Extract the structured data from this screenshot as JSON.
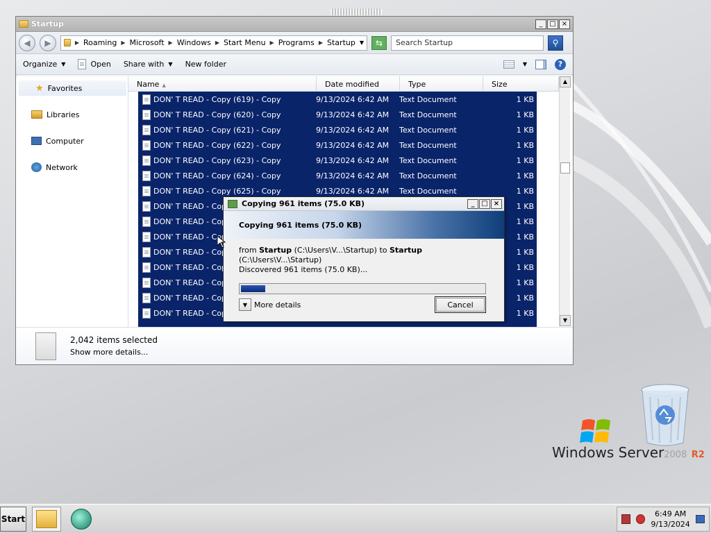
{
  "explorer": {
    "title": "Startup",
    "breadcrumb": [
      "Roaming",
      "Microsoft",
      "Windows",
      "Start Menu",
      "Programs",
      "Startup"
    ],
    "search_placeholder": "Search Startup",
    "toolbar": {
      "organize": "Organize",
      "open": "Open",
      "share_with": "Share with",
      "new_folder": "New folder"
    },
    "nav": {
      "favorites": "Favorites",
      "libraries": "Libraries",
      "computer": "Computer",
      "network": "Network"
    },
    "columns": {
      "name": "Name",
      "date": "Date modified",
      "type": "Type",
      "size": "Size"
    },
    "rows": [
      {
        "name": "DON' T READ - Copy (619) - Copy",
        "date": "9/13/2024 6:42 AM",
        "type": "Text Document",
        "size": "1 KB"
      },
      {
        "name": "DON' T READ - Copy (620) - Copy",
        "date": "9/13/2024 6:42 AM",
        "type": "Text Document",
        "size": "1 KB"
      },
      {
        "name": "DON' T READ - Copy (621) - Copy",
        "date": "9/13/2024 6:42 AM",
        "type": "Text Document",
        "size": "1 KB"
      },
      {
        "name": "DON' T READ - Copy (622) - Copy",
        "date": "9/13/2024 6:42 AM",
        "type": "Text Document",
        "size": "1 KB"
      },
      {
        "name": "DON' T READ - Copy (623) - Copy",
        "date": "9/13/2024 6:42 AM",
        "type": "Text Document",
        "size": "1 KB"
      },
      {
        "name": "DON' T READ - Copy (624) - Copy",
        "date": "9/13/2024 6:42 AM",
        "type": "Text Document",
        "size": "1 KB"
      },
      {
        "name": "DON' T READ - Copy (625) - Copy",
        "date": "9/13/2024 6:42 AM",
        "type": "Text Document",
        "size": "1 KB"
      },
      {
        "name": "DON' T READ - Copy",
        "date": "",
        "type": "",
        "size": "1 KB"
      },
      {
        "name": "DON' T READ - Copy",
        "date": "",
        "type": "",
        "size": "1 KB"
      },
      {
        "name": "DON' T READ - Copy",
        "date": "",
        "type": "",
        "size": "1 KB"
      },
      {
        "name": "DON' T READ - Copy",
        "date": "",
        "type": "",
        "size": "1 KB"
      },
      {
        "name": "DON' T READ - Copy",
        "date": "",
        "type": "",
        "size": "1 KB"
      },
      {
        "name": "DON' T READ - Copy",
        "date": "",
        "type": "",
        "size": "1 KB"
      },
      {
        "name": "DON' T READ - Copy",
        "date": "",
        "type": "",
        "size": "1 KB"
      },
      {
        "name": "DON' T READ - Copy",
        "date": "",
        "type": "",
        "size": "1 KB"
      }
    ],
    "details": {
      "count": "2,042 items selected",
      "more": "Show more details..."
    }
  },
  "dialog": {
    "title": "Copying 961 items (75.0 KB)",
    "banner": "Copying 961 items (75.0 KB)",
    "from_label": "from",
    "from_name": "Startup",
    "from_path": "(C:\\Users\\V...\\Startup)",
    "to_label": "to",
    "to_name": "Startup",
    "to_path": "(C:\\Users\\V...\\Startup)",
    "status": "Discovered 961 items (75.0 KB)...",
    "progress_percent": 10,
    "more_details": "More details",
    "cancel": "Cancel"
  },
  "desktop": {
    "logo_main": "Windows Server",
    "logo_version": "2008",
    "logo_r2": "R2"
  },
  "taskbar": {
    "start": "Start",
    "time": "6:49 AM",
    "date": "9/13/2024"
  },
  "colors": {
    "selection": "#0a246a",
    "progress": "#0b2c7a",
    "accent_r2": "#e35a2b"
  }
}
